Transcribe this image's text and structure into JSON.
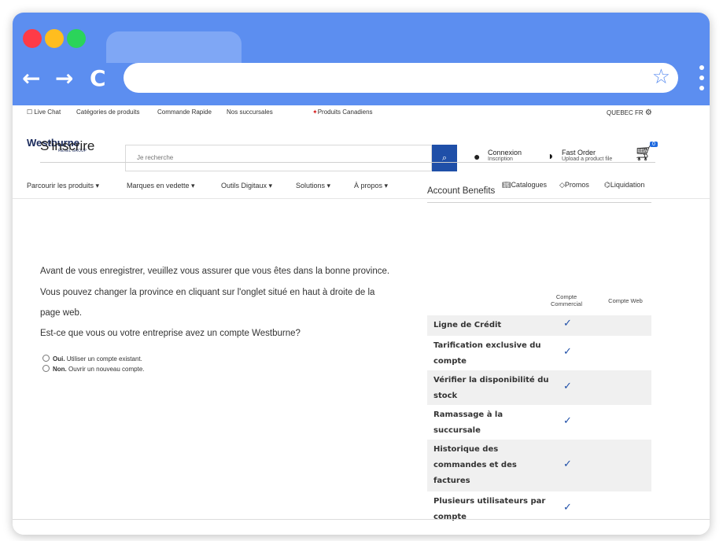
{
  "browser": {
    "nav": {
      "back": "←",
      "forward": "→",
      "reload": "C"
    },
    "star_icon": "star-icon"
  },
  "utility_bar": {
    "live_chat": "Live Chat",
    "categories": "Catégories de produits",
    "quick_order": "Commande Rapide",
    "branches": "Nos succursales",
    "canadian": "Produits Canadiens",
    "region": "QUEBEC FR"
  },
  "header": {
    "logo": "Westburne",
    "logo_sub": "REXEL GROUP",
    "search_placeholder": "Je recherche",
    "login_title": "Connexion",
    "login_sub": "Inscription",
    "fast_order_title": "Fast Order",
    "fast_order_sub": "Upload a product file",
    "cart_count": "0"
  },
  "category_nav": {
    "items": [
      "Parcourir les produits ▾",
      "Marques en vedette ▾",
      "Outils Digitaux ▾",
      "Solutions ▾",
      "À propos ▾"
    ],
    "catalogues": "Catalogues",
    "promos": "Promos",
    "liquidation": "Liquidation"
  },
  "main": {
    "title": "S'inscrire",
    "para1": "Avant de vous enregistrer, veuillez vous assurer que vous êtes dans la bonne province.",
    "para2": "Vous pouvez changer la province en cliquant sur l'onglet situé en haut à droite de la",
    "para3": "page web.",
    "question": "Est-ce que vous ou votre entreprise avez un compte Westburne?",
    "option_yes_bold": "Oui.",
    "option_yes": "Utiliser un compte existant.",
    "option_no_bold": "Non.",
    "option_no": "Ouvrir un nouveau compte."
  },
  "benefits": {
    "title": "Account Benefits",
    "col_commercial": "Compte Commercial",
    "col_web": "Compte Web",
    "rows": [
      {
        "label": "Ligne de Crédit",
        "commercial": "✓"
      },
      {
        "label": "Tarification exclusive du compte",
        "commercial": "✓"
      },
      {
        "label": "Vérifier la disponibilité du stock",
        "commercial": "✓"
      },
      {
        "label": "Ramassage à la succursale",
        "commercial": "✓"
      },
      {
        "label": "Historique des commandes et des factures",
        "commercial": "✓"
      },
      {
        "label": "Plusieurs utilisateurs par compte",
        "commercial": "✓"
      }
    ]
  },
  "colors": {
    "browser_chrome": "#5c8ef0",
    "brand_blue": "#1f4fa8",
    "maple_red": "#d62020"
  }
}
